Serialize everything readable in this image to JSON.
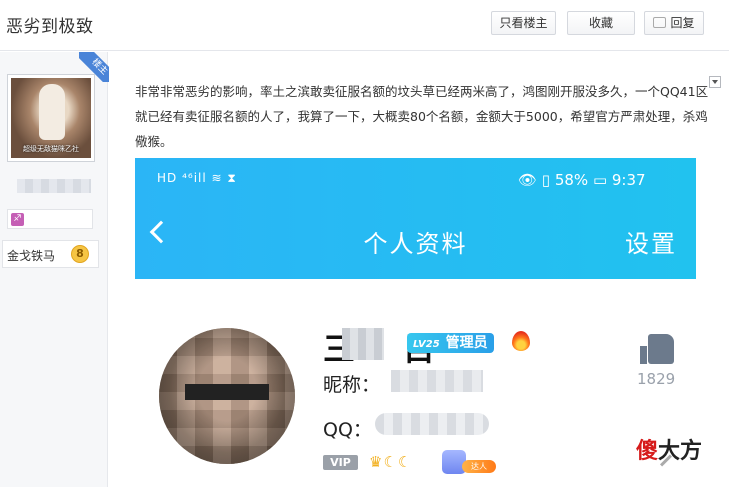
{
  "header": {
    "title": "恶劣到极致",
    "btn_only_author": "只看楼主",
    "btn_collect": "收藏",
    "btn_reply": "回复"
  },
  "author": {
    "avatar_caption": "超级无敌猫咪乙社",
    "badge": "楼主",
    "constellation_icon": "♐",
    "level_name": "金戈铁马",
    "level_num": "8"
  },
  "post": {
    "text": "非常非常恶劣的影响，率土之滨敢卖征服名额的坟头草已经两米高了，鸿图刚开服没多久，一个QQ41区就已经有卖征服名额的人了，我算了一下，大概卖80个名额，金额大于5000，希望官方严肃处理，杀鸡儆猴。"
  },
  "screenshot": {
    "status_left": "HD ⁴⁶ill ≋ ⧗",
    "status_right": "👁 ▯ 58% ▭ 9:37",
    "nav_title": "个人资料",
    "nav_settings": "设置",
    "name_char": "三",
    "name_tail": "目",
    "level_tag": "LV25",
    "role": "管理员",
    "nickname_label": "昵称：",
    "qq_label": "QQ：",
    "vip": "VIP",
    "crowns": "♛☾☾",
    "talent": "达人",
    "likes": "1829"
  },
  "watermark": {
    "red_char": "傻",
    "black_chars": "大方"
  },
  "colors": {
    "accent_blue": "#2bb5f6",
    "badge_blue": "#4a84d8",
    "watermark_red": "#d61b1b"
  }
}
